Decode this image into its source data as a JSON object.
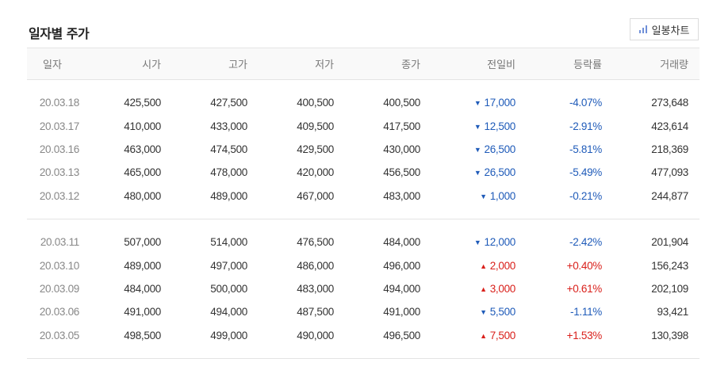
{
  "title": "일자별 주가",
  "daily_chart_button": "일봉차트",
  "columns": [
    "일자",
    "시가",
    "고가",
    "저가",
    "종가",
    "전일비",
    "등락률",
    "거래량"
  ],
  "groups": [
    [
      {
        "date": "20.03.18",
        "open": "425,500",
        "high": "427,500",
        "low": "400,500",
        "close": "400,500",
        "dir": "down",
        "change": "17,000",
        "rate": "-4.07%",
        "volume": "273,648"
      },
      {
        "date": "20.03.17",
        "open": "410,000",
        "high": "433,000",
        "low": "409,500",
        "close": "417,500",
        "dir": "down",
        "change": "12,500",
        "rate": "-2.91%",
        "volume": "423,614"
      },
      {
        "date": "20.03.16",
        "open": "463,000",
        "high": "474,500",
        "low": "429,500",
        "close": "430,000",
        "dir": "down",
        "change": "26,500",
        "rate": "-5.81%",
        "volume": "218,369"
      },
      {
        "date": "20.03.13",
        "open": "465,000",
        "high": "478,000",
        "low": "420,000",
        "close": "456,500",
        "dir": "down",
        "change": "26,500",
        "rate": "-5.49%",
        "volume": "477,093"
      },
      {
        "date": "20.03.12",
        "open": "480,000",
        "high": "489,000",
        "low": "467,000",
        "close": "483,000",
        "dir": "down",
        "change": "1,000",
        "rate": "-0.21%",
        "volume": "244,877"
      }
    ],
    [
      {
        "date": "20.03.11",
        "open": "507,000",
        "high": "514,000",
        "low": "476,500",
        "close": "484,000",
        "dir": "down",
        "change": "12,000",
        "rate": "-2.42%",
        "volume": "201,904"
      },
      {
        "date": "20.03.10",
        "open": "489,000",
        "high": "497,000",
        "low": "486,000",
        "close": "496,000",
        "dir": "up",
        "change": "2,000",
        "rate": "+0.40%",
        "volume": "156,243"
      },
      {
        "date": "20.03.09",
        "open": "484,000",
        "high": "500,000",
        "low": "483,000",
        "close": "494,000",
        "dir": "up",
        "change": "3,000",
        "rate": "+0.61%",
        "volume": "202,109"
      },
      {
        "date": "20.03.06",
        "open": "491,000",
        "high": "494,000",
        "low": "487,500",
        "close": "491,000",
        "dir": "down",
        "change": "5,500",
        "rate": "-1.11%",
        "volume": "93,421"
      },
      {
        "date": "20.03.05",
        "open": "498,500",
        "high": "499,000",
        "low": "490,000",
        "close": "496,500",
        "dir": "up",
        "change": "7,500",
        "rate": "+1.53%",
        "volume": "130,398"
      }
    ]
  ],
  "colors": {
    "down": "#1f5bb9",
    "up": "#d9201b"
  },
  "arrows": {
    "down": "▼",
    "up": "▲"
  }
}
